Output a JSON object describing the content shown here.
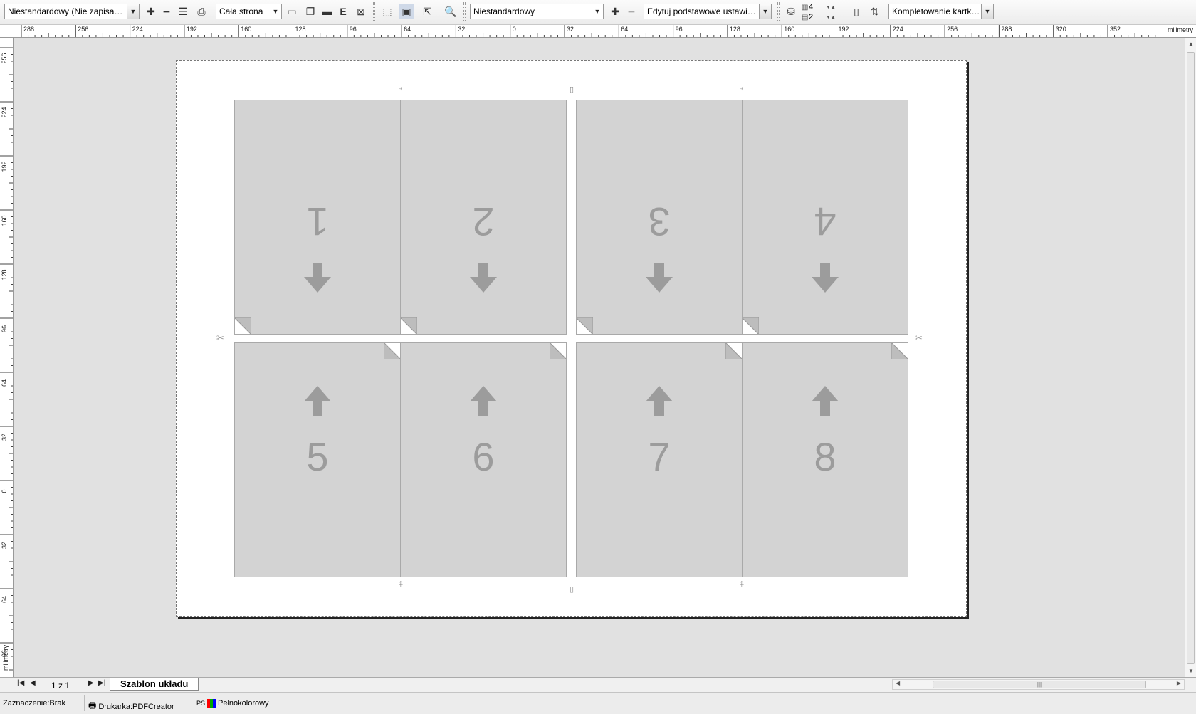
{
  "toolbar": {
    "layout_preset": "Niestandardowy (Nie zapisano ...",
    "view_mode": "Cała strona",
    "template": "Niestandardowy",
    "settings": "Edytuj podstawowe ustawienia",
    "cols_value": "4",
    "rows_value": "2",
    "collation": "Kompletowanie kartkowe"
  },
  "ruler": {
    "unit": "milimetry",
    "h_labels": [
      "288",
      "256",
      "224",
      "192",
      "160",
      "128",
      "96",
      "64",
      "32",
      "0",
      "32",
      "64",
      "96",
      "128",
      "160",
      "192",
      "224",
      "256",
      "288",
      "320",
      "352"
    ],
    "v_labels": [
      "256",
      "224",
      "192",
      "160",
      "128",
      "96",
      "64",
      "32",
      "0",
      "32",
      "64",
      "96"
    ]
  },
  "sheet": {
    "pages": [
      {
        "number": "1",
        "row": "top"
      },
      {
        "number": "2",
        "row": "top"
      },
      {
        "number": "3",
        "row": "top"
      },
      {
        "number": "4",
        "row": "top"
      },
      {
        "number": "5",
        "row": "bottom"
      },
      {
        "number": "6",
        "row": "bottom"
      },
      {
        "number": "7",
        "row": "bottom"
      },
      {
        "number": "8",
        "row": "bottom"
      }
    ]
  },
  "tabs": {
    "page_count": "1 z 1",
    "active_tab": "Szablon układu"
  },
  "status": {
    "selection": "Zaznaczenie:Brak",
    "printer": "Drukarka:PDFCreator",
    "ps_label": "PS",
    "color_mode": "Pełnokolorowy"
  },
  "colors": {
    "page_fill": "#d3d3d3",
    "page_glyph": "#9c9c9c",
    "canvas_bg": "#e1e1e1"
  }
}
